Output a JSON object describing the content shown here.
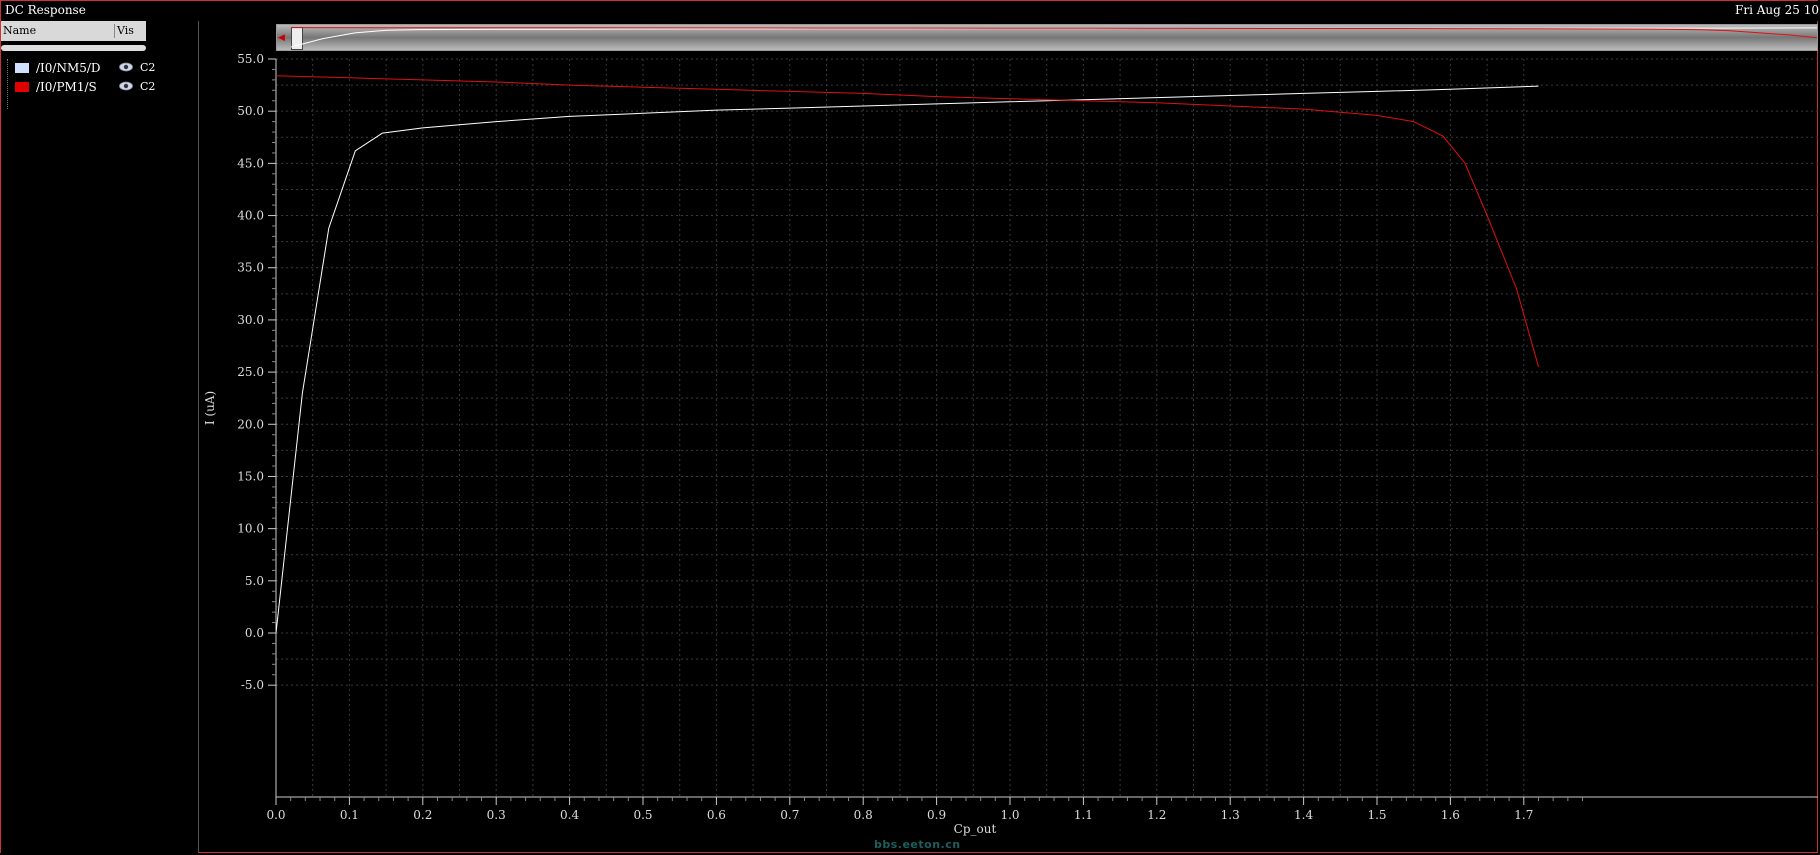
{
  "window": {
    "title": "DC Response",
    "datetime": "Fri Aug 25 10"
  },
  "panel": {
    "col_name": "Name",
    "col_vis": "Vis",
    "signals": [
      {
        "name": "/I0/NM5/D",
        "group": "C2",
        "color": "#cfe0ff",
        "visible": true
      },
      {
        "name": "/I0/PM1/S",
        "group": "C2",
        "color": "#e00000",
        "visible": true
      }
    ]
  },
  "watermark": "bbs.eeton.cn",
  "chart_data": {
    "type": "line",
    "xlabel": "Cp_out",
    "ylabel": "I (uA)",
    "xlim": [
      0.0,
      1.72
    ],
    "ylim": [
      -5.0,
      55.0
    ],
    "xticks": [
      0.0,
      0.1,
      0.2,
      0.3,
      0.4,
      0.5,
      0.6,
      0.7,
      0.8,
      0.9,
      1.0,
      1.1,
      1.2,
      1.3,
      1.4,
      1.5,
      1.6,
      1.7
    ],
    "xtick_labels": [
      "0.0",
      "0.1",
      "0.2",
      "0.3",
      "0.4",
      "0.5",
      "0.6",
      "0.7",
      "0.8",
      "0.9",
      "1.0",
      "1.1",
      "1.2",
      "1.3",
      "1.4",
      "1.5",
      "1.6",
      "1.7"
    ],
    "yticks": [
      -5.0,
      0.0,
      5.0,
      10.0,
      15.0,
      20.0,
      25.0,
      30.0,
      35.0,
      40.0,
      45.0,
      50.0,
      55.0
    ],
    "ytick_labels": [
      "-5.0",
      "0.0",
      "5.0",
      "10.0",
      "15.0",
      "20.0",
      "25.0",
      "30.0",
      "35.0",
      "40.0",
      "45.0",
      "50.0",
      "55.0"
    ],
    "grid": true,
    "series": [
      {
        "name": "/I0/NM5/D",
        "color": "#ffffff",
        "x": [
          0.0,
          0.036,
          0.072,
          0.108,
          0.145,
          0.2,
          0.3,
          0.4,
          0.5,
          0.6,
          0.7,
          0.8,
          0.9,
          1.0,
          1.1,
          1.2,
          1.3,
          1.4,
          1.5,
          1.6,
          1.72
        ],
        "y": [
          0.0,
          23.0,
          38.8,
          46.2,
          47.9,
          48.4,
          49.0,
          49.5,
          49.8,
          50.1,
          50.3,
          50.5,
          50.7,
          50.9,
          51.1,
          51.3,
          51.5,
          51.7,
          51.9,
          52.1,
          52.4
        ]
      },
      {
        "name": "/I0/PM1/S",
        "color": "#e01010",
        "x": [
          0.0,
          0.1,
          0.2,
          0.3,
          0.4,
          0.5,
          0.6,
          0.7,
          0.8,
          0.9,
          1.0,
          1.1,
          1.2,
          1.3,
          1.4,
          1.5,
          1.55,
          1.59,
          1.62,
          1.65,
          1.69,
          1.72
        ],
        "y": [
          53.4,
          53.2,
          53.0,
          52.8,
          52.5,
          52.3,
          52.1,
          51.9,
          51.7,
          51.4,
          51.2,
          51.0,
          50.8,
          50.5,
          50.2,
          49.6,
          49.0,
          47.6,
          45.0,
          40.0,
          33.0,
          25.5
        ]
      }
    ]
  }
}
